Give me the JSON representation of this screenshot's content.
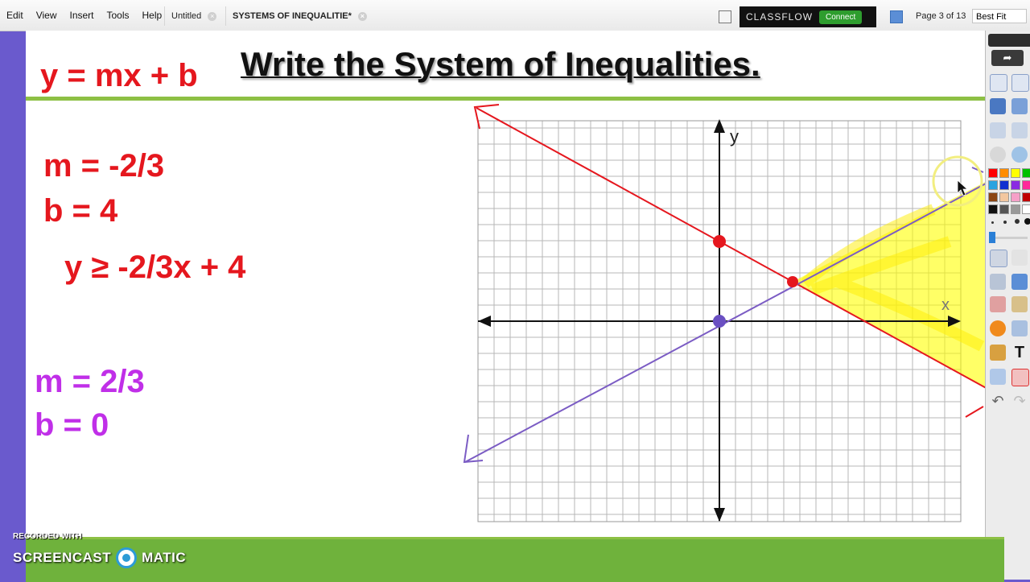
{
  "menu": [
    "Edit",
    "View",
    "Insert",
    "Tools",
    "Help"
  ],
  "tabs": [
    {
      "label": "Untitled",
      "active": false
    },
    {
      "label": "SYSTEMS OF INEQUALITIE*",
      "active": true
    }
  ],
  "brand": {
    "name": "CLASSFLOW",
    "connect_label": "Connect"
  },
  "page_indicator": "Page 3 of 13",
  "zoom_select": "Best Fit",
  "slide": {
    "title": "Write the System of Inequalities.",
    "formula": "y = mx + b",
    "red_slope": "m = -2/3",
    "red_intercept": "b = 4",
    "inequality": "y ≥ -2/3x + 4",
    "purple_slope": "m = 2/3",
    "purple_intercept": "b = 0",
    "axis_x_label": "x",
    "axis_y_label": "y"
  },
  "colors": {
    "red_line": "#e5171e",
    "purple_line": "#7b5cc4",
    "highlight": "#ffff00",
    "accent_green": "#8dc044"
  },
  "watermark": {
    "recorded": "RECORDED WITH",
    "left": "SCREENCAST",
    "right": "MATIC"
  },
  "palette_icons": [
    "share-icon",
    "page-icon",
    "pen-icon",
    "arrow-select-icon",
    "highlighter-icon",
    "eraser-icon",
    "shape-icon",
    "text-icon",
    "undo-icon",
    "redo-icon"
  ]
}
